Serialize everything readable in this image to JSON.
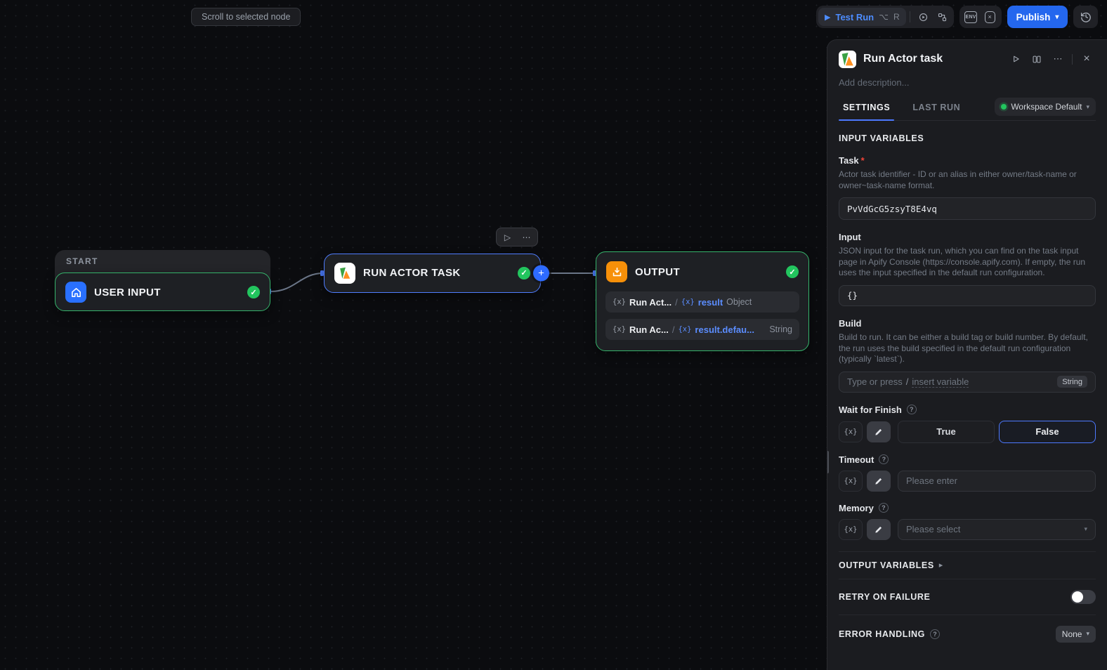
{
  "icons": {
    "play": "▶",
    "play_outline": "▷",
    "ellipsis": "⋯",
    "close": "×",
    "check": "✓",
    "plus": "+",
    "chevron_down": "▾",
    "arrow_right": "▸",
    "question": "?",
    "var": "{x}",
    "env": "ENV",
    "x_small": "×"
  },
  "scroll_button": {
    "label": "Scroll to selected node"
  },
  "toolbar": {
    "test_run_label": "Test Run",
    "shortcut_modifier": "⌥",
    "shortcut_key": "R",
    "publish_label": "Publish"
  },
  "canvas": {
    "start_badge": "START",
    "user_input_title": "USER INPUT",
    "run_actor_title": "RUN ACTOR TASK",
    "output_title": "OUTPUT",
    "output_rows": [
      {
        "var_prefix": "{x}",
        "source": "Run Act...",
        "slash": "/",
        "x_badge": "{x}",
        "path": "result",
        "type": "Object"
      },
      {
        "var_prefix": "{x}",
        "source": "Run Ac...",
        "slash": "/",
        "x_badge": "{x}",
        "path": "result.defau...",
        "type": "String"
      }
    ]
  },
  "panel": {
    "title": "Run Actor task",
    "description_placeholder": "Add description...",
    "tab_settings": "SETTINGS",
    "tab_last_run": "LAST RUN",
    "workspace_label": "Workspace Default",
    "input_variables_header": "INPUT VARIABLES",
    "task": {
      "label": "Task",
      "required_mark": "*",
      "description": "Actor task identifier - ID or an alias in either owner/task-name or owner~task-name format.",
      "value": "PvVdGcG5zsyT8E4vq"
    },
    "input": {
      "label": "Input",
      "description": "JSON input for the task run, which you can find on the task input page in Apify Console (https://console.apify.com). If empty, the run uses the input specified in the default run configuration.",
      "value": "{}"
    },
    "build": {
      "label": "Build",
      "description": "Build to run. It can be either a build tag or build number. By default, the run uses the build specified in the default run configuration (typically `latest`).",
      "placeholder_prefix": "Type or press",
      "placeholder_key": "/",
      "placeholder_link": "insert variable",
      "type_badge": "String"
    },
    "wait_for_finish": {
      "label": "Wait for Finish",
      "var_button": "{x}",
      "true_label": "True",
      "false_label": "False"
    },
    "timeout": {
      "label": "Timeout",
      "var_button": "{x}",
      "placeholder": "Please enter"
    },
    "memory": {
      "label": "Memory",
      "var_button": "{x}",
      "placeholder": "Please select"
    },
    "output_variables_header": "OUTPUT VARIABLES",
    "retry_header": "RETRY ON FAILURE",
    "error_header": "ERROR HANDLING",
    "error_value": "None"
  }
}
